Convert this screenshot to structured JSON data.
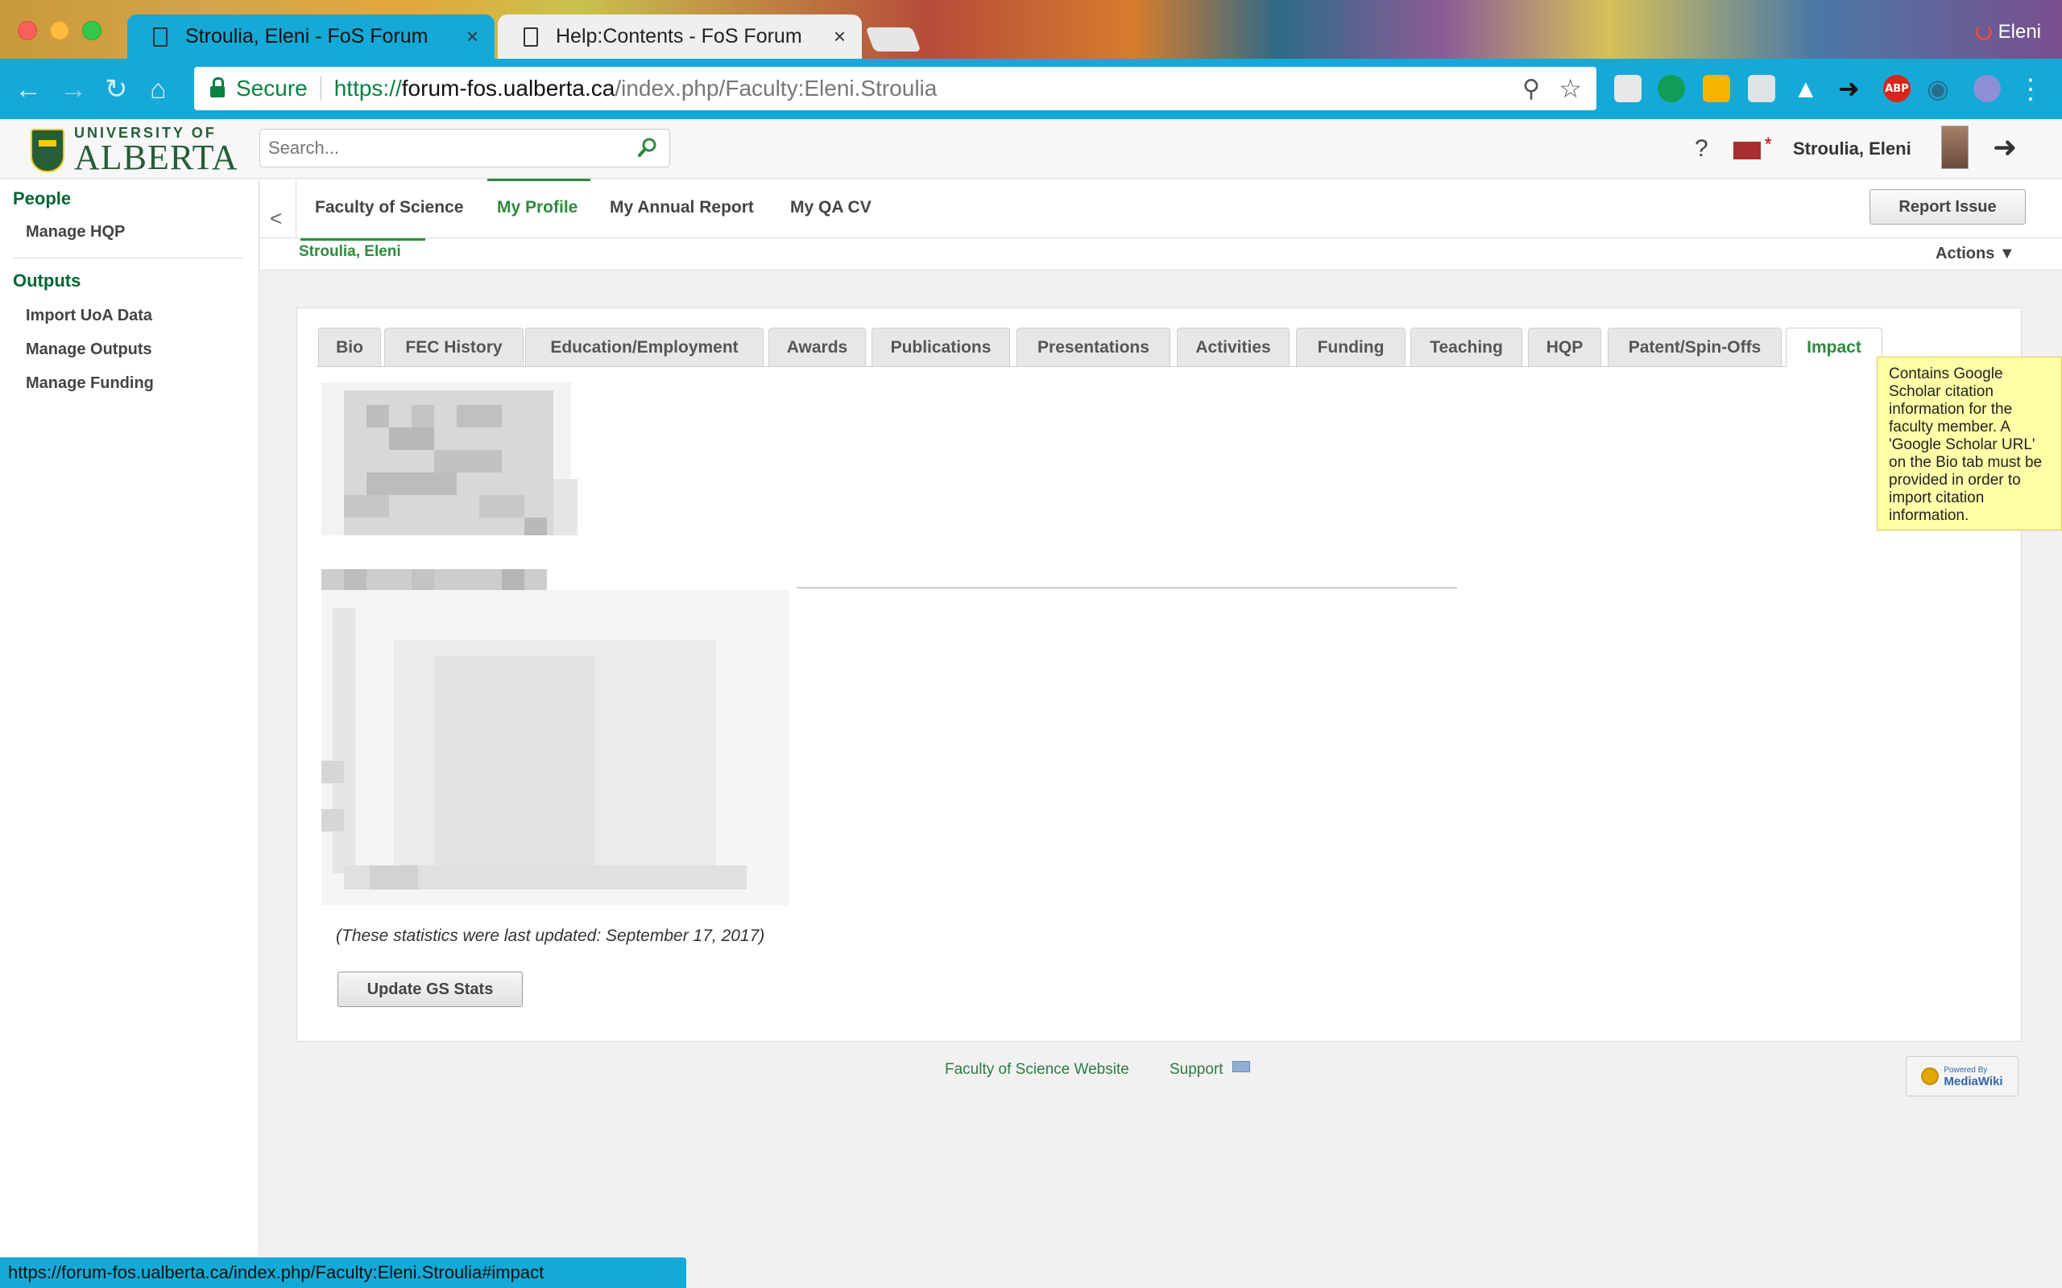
{
  "browser": {
    "tabs": [
      {
        "title": "Stroulia, Eleni - FoS Forum",
        "close": "×"
      },
      {
        "title": "Help:Contents - FoS Forum",
        "close": "×"
      }
    ],
    "profile_name": "Eleni",
    "security_label": "Secure",
    "url": {
      "scheme": "https://",
      "host": "forum-fos.ualberta.ca",
      "path": "/index.php/Faculty:Eleni.Stroulia"
    },
    "extensions": [
      "extension-icon",
      "hangouts-icon",
      "rss-icon",
      "cast-icon",
      "drive-icon",
      "share-arrow-icon",
      "adblock-plus-icon",
      "eye-icon",
      "vpn-icon"
    ],
    "abp_label": "ABP",
    "status_url": "https://forum-fos.ualberta.ca/index.php/Faculty:Eleni.Stroulia#impact"
  },
  "header": {
    "logo_top": "UNIVERSITY OF",
    "logo_bottom": "ALBERTA",
    "search_placeholder": "Search...",
    "help": "?",
    "user_name": "Stroulia, Eleni"
  },
  "sidebar": {
    "sections": [
      {
        "heading": "People",
        "items": [
          "Manage HQP"
        ]
      },
      {
        "heading": "Outputs",
        "items": [
          "Import UoA Data",
          "Manage Outputs",
          "Manage Funding"
        ]
      }
    ]
  },
  "nav": {
    "collapse": "<",
    "tabs": [
      "Faculty of Science",
      "My Profile",
      "My Annual Report",
      "My QA CV"
    ],
    "selected_tab": "My Profile",
    "report_issue": "Report Issue",
    "sub_tab": "Stroulia, Eleni",
    "actions": "Actions ▼"
  },
  "profile": {
    "tabs": [
      "Bio",
      "FEC History",
      "Education/Employment",
      "Awards",
      "Publications",
      "Presentations",
      "Activities",
      "Funding",
      "Teaching",
      "HQP",
      "Patent/Spin-Offs",
      "Impact"
    ],
    "selected_tab": "Impact",
    "tooltip": "Contains Google Scholar citation information for the faculty member. A 'Google Scholar URL' on the Bio tab must be provided in order to import citation information.",
    "stats_note": "(These statistics were last updated: September 17, 2017)",
    "update_button": "Update GS Stats"
  },
  "footer": {
    "links": [
      "Faculty of Science Website",
      "Support"
    ],
    "badge_line1": "Powered By",
    "badge_line2": "MediaWiki"
  },
  "colors": {
    "chrome": "#14a9d6",
    "brand_green": "#275d38",
    "link_green": "#2e8a3e",
    "tooltip_bg": "#ffffa8"
  }
}
